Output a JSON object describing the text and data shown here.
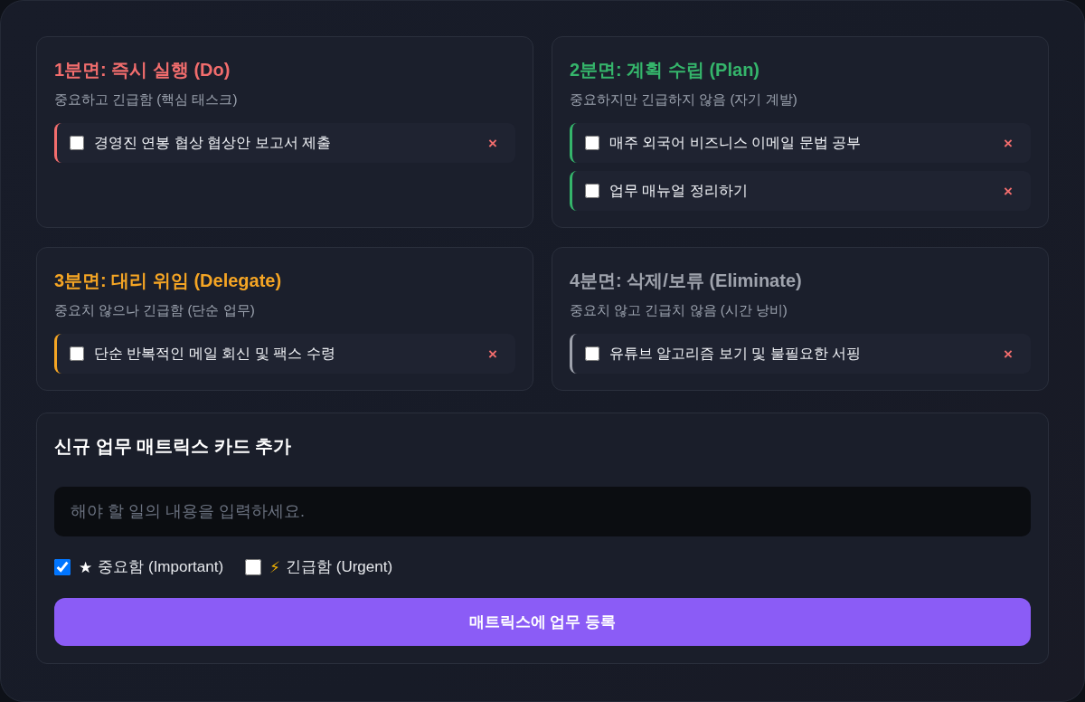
{
  "quadrants": [
    {
      "title": "1분면: 즉시 실행 (Do)",
      "subtitle": "중요하고 긴급함 (핵심 태스크)",
      "color": "#f26d6d",
      "tasks": [
        {
          "text": "경영진 연봉 협상 협상안 보고서 제출",
          "checked": false,
          "delete": "×"
        }
      ]
    },
    {
      "title": "2분면: 계획 수립 (Plan)",
      "subtitle": "중요하지만 긴급하지 않음 (자기 계발)",
      "color": "#35b56b",
      "tasks": [
        {
          "text": "매주 외국어 비즈니스 이메일 문법 공부",
          "checked": false,
          "delete": "×"
        },
        {
          "text": "업무 매뉴얼 정리하기",
          "checked": false,
          "delete": "×"
        }
      ]
    },
    {
      "title": "3분면: 대리 위임 (Delegate)",
      "subtitle": "중요치 않으나 긴급함 (단순 업무)",
      "color": "#f5a524",
      "tasks": [
        {
          "text": "단순 반복적인 메일 회신 및 팩스 수령",
          "checked": false,
          "delete": "×"
        }
      ]
    },
    {
      "title": "4분면: 삭제/보류 (Eliminate)",
      "subtitle": "중요치 않고 긴급치 않음 (시간 낭비)",
      "color": "#9fa3ad",
      "tasks": [
        {
          "text": "유튜브 알고리즘 보기 및 불필요한 서핑",
          "checked": false,
          "delete": "×"
        }
      ]
    }
  ],
  "add_form": {
    "title": "신규 업무 매트릭스 카드 추가",
    "input": {
      "placeholder": "해야 할 일의 내용을 입력하세요."
    },
    "options": [
      {
        "icon": "★",
        "label": "중요함 (Important)",
        "checked": true
      },
      {
        "icon": "⚡",
        "label": "긴급함 (Urgent)",
        "checked": false
      }
    ],
    "submit": "매트릭스에 업무 등록"
  }
}
